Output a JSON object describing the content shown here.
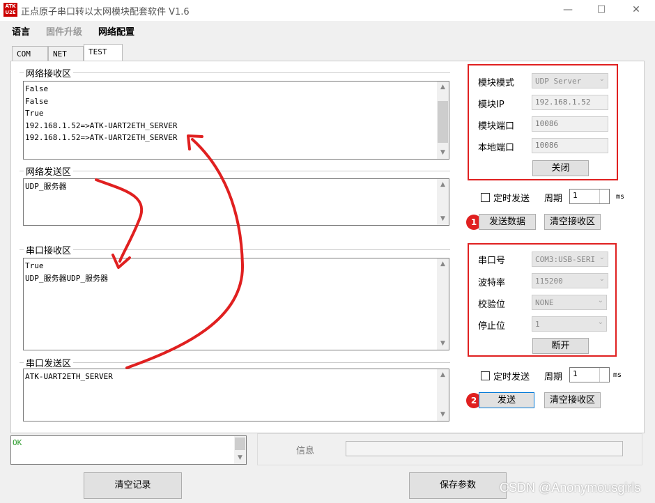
{
  "window": {
    "icon_text": "ATK\nU2E",
    "title": "正点原子串口转以太网模块配套软件 V1.6",
    "minimize": "—",
    "maximize": "☐",
    "close": "✕"
  },
  "menu": [
    {
      "label": "语言",
      "enabled": true
    },
    {
      "label": "固件升级",
      "enabled": false
    },
    {
      "label": "网络配置",
      "enabled": true
    }
  ],
  "tabs": [
    {
      "label": "COM",
      "active": false
    },
    {
      "label": "NET",
      "active": false
    },
    {
      "label": "TEST",
      "active": true
    }
  ],
  "net_recv": {
    "label": "网络接收区",
    "text": "False\nFalse\nTrue\n192.168.1.52=>ATK-UART2ETH_SERVER\n192.168.1.52=>ATK-UART2ETH_SERVER"
  },
  "net_send": {
    "label": "网络发送区",
    "text": "UDP_服务器"
  },
  "serial_recv": {
    "label": "串口接收区",
    "text": "True\nUDP_服务器UDP_服务器"
  },
  "serial_send": {
    "label": "串口发送区",
    "text": "ATK-UART2ETH_SERVER"
  },
  "net_config": {
    "mode_label": "模块模式",
    "mode_value": "UDP Server",
    "ip_label": "模块IP",
    "ip_value": "192.168.1.52",
    "port_label": "模块端口",
    "port_value": "10086",
    "local_port_label": "本地端口",
    "local_port_value": "10086",
    "close_button": "关闭"
  },
  "net_timer": {
    "checkbox_label": "定时发送",
    "period_label": "周期",
    "period_value": "1",
    "unit": "ms"
  },
  "net_actions": {
    "marker": "1",
    "send_button": "发送数据",
    "clear_button": "清空接收区"
  },
  "serial_config": {
    "port_label": "串口号",
    "port_value": "COM3:USB-SERI",
    "baud_label": "波特率",
    "baud_value": "115200",
    "parity_label": "校验位",
    "parity_value": "NONE",
    "stop_label": "停止位",
    "stop_value": "1",
    "disconnect_button": "断开"
  },
  "serial_timer": {
    "checkbox_label": "定时发送",
    "period_label": "周期",
    "period_value": "1",
    "unit": "ms"
  },
  "serial_actions": {
    "marker": "2",
    "send_button": "发送",
    "clear_button": "清空接收区"
  },
  "log": {
    "text": "OK",
    "info_label": "信息"
  },
  "bottom": {
    "clear_log_button": "清空记录",
    "save_button": "保存参数"
  },
  "watermark": "CSDN @Anonymousgirls",
  "colors": {
    "annotation_red": "#e02020",
    "ok_green": "#2a9a2a",
    "focus_blue": "#0078d7"
  }
}
